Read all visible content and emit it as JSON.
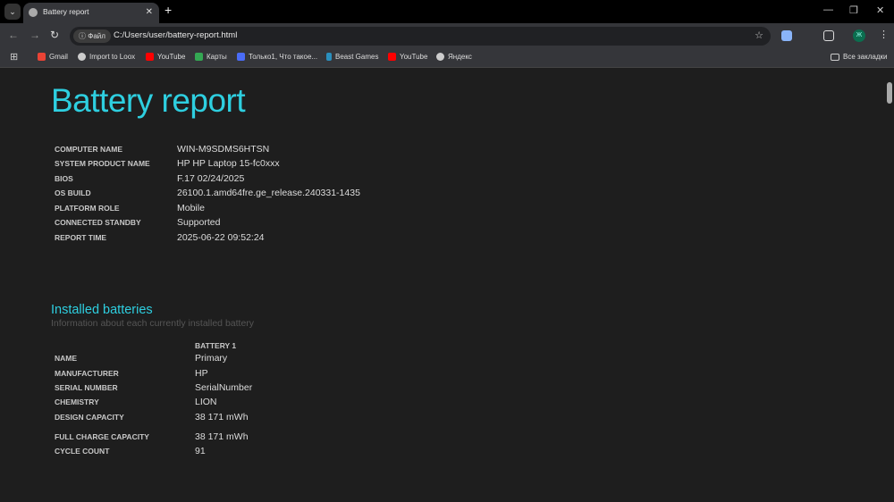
{
  "browser": {
    "tab_title": "Battery report",
    "url": "C:/Users/user/battery-report.html",
    "security_chip": "Файл",
    "avatar_letter": "Ж",
    "bookmarks": [
      "Gmail",
      "Import to Loox",
      "YouTube",
      "Карты",
      "Только1, Что такое...",
      "Beast Games",
      "YouTube",
      "Яндекс"
    ],
    "all_bookmarks": "Все закладки"
  },
  "report": {
    "title": "Battery report",
    "system": [
      {
        "label": "COMPUTER NAME",
        "value": "WIN-M9SDMS6HTSN"
      },
      {
        "label": "SYSTEM PRODUCT NAME",
        "value": "HP HP Laptop 15-fc0xxx"
      },
      {
        "label": "BIOS",
        "value": "F.17 02/24/2025"
      },
      {
        "label": "OS BUILD",
        "value": "26100.1.amd64fre.ge_release.240331-1435"
      },
      {
        "label": "PLATFORM ROLE",
        "value": "Mobile"
      },
      {
        "label": "CONNECTED STANDBY",
        "value": "Supported"
      },
      {
        "label": "REPORT TIME",
        "value": "2025-06-22  09:52:24"
      }
    ],
    "installed": {
      "heading": "Installed batteries",
      "subtitle": "Information about each currently installed battery",
      "column": "BATTERY 1",
      "rows": [
        {
          "label": "NAME",
          "value": "Primary"
        },
        {
          "label": "MANUFACTURER",
          "value": "HP"
        },
        {
          "label": "SERIAL NUMBER",
          "value": "SerialNumber"
        },
        {
          "label": "CHEMISTRY",
          "value": "LION"
        },
        {
          "label": "DESIGN CAPACITY",
          "value": "38 171 mWh"
        },
        {
          "label": "FULL CHARGE CAPACITY",
          "value": "38 171 mWh"
        },
        {
          "label": "CYCLE COUNT",
          "value": "91"
        }
      ]
    }
  }
}
